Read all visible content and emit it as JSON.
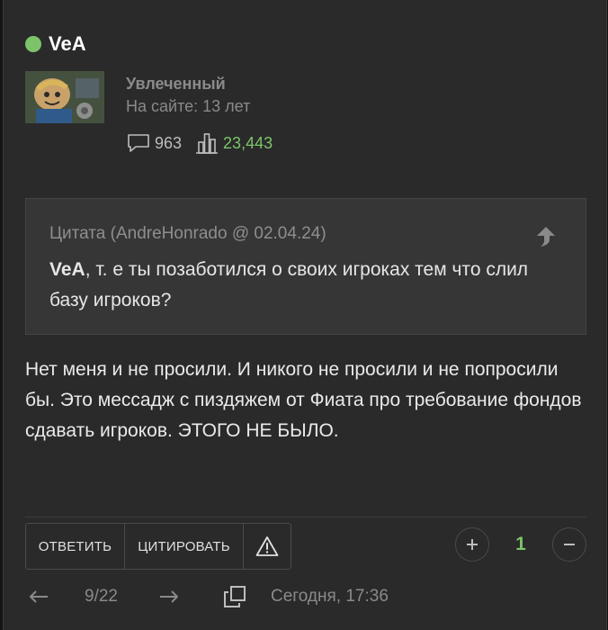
{
  "author": {
    "username": "VeA",
    "rank": "Увлеченный",
    "site_age": "На сайте: 13 лет",
    "comments_count": "963",
    "rating": "23,443",
    "online_color": "#7cc46a"
  },
  "quote": {
    "header": "Цитата (AndreHonrado @ 02.04.24)",
    "addressee": "VeA",
    "text": ", т. е   ты позаботился о своих игроках тем что слил базу игроков?"
  },
  "message": "Нет меня и не просили. И никого не просили и не попросили бы. Это мессадж с пиздяжем от Фиата про требование фондов сдавать игроков. ЭТОГО НЕ БЫЛО.",
  "actions": {
    "reply": "ОТВЕТИТЬ",
    "quote": "ЦИТИРОВАТЬ"
  },
  "vote": {
    "count": "1"
  },
  "pager": {
    "position": "9/22"
  },
  "timestamp": "Сегодня, 17:36",
  "icons": {
    "online": "online-dot",
    "comments": "speech-bubble-icon",
    "rating": "bar-chart-icon",
    "quote_jump": "arrow-up-icon",
    "report": "warning-triangle-icon",
    "upvote": "plus-icon",
    "downvote": "minus-icon",
    "prev": "arrow-left-icon",
    "next": "arrow-right-icon",
    "copy": "copy-link-icon"
  }
}
